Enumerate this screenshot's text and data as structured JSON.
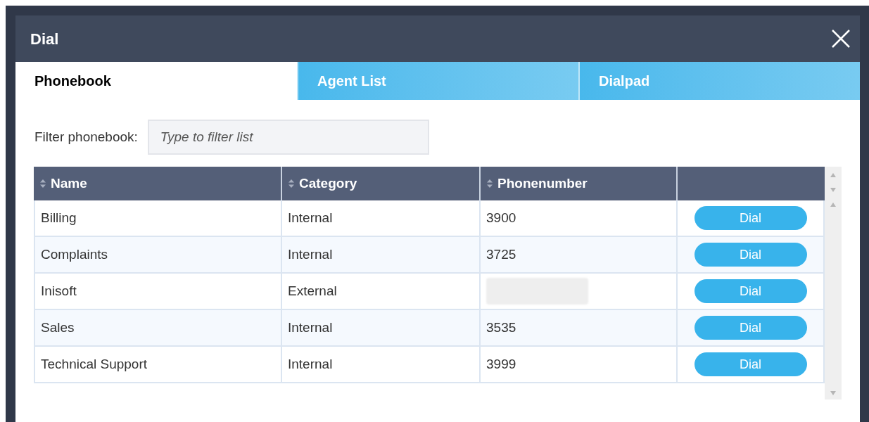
{
  "window": {
    "title": "Dial"
  },
  "tabs": [
    {
      "label": "Phonebook",
      "selected": true
    },
    {
      "label": "Agent List",
      "selected": false
    },
    {
      "label": "Dialpad",
      "selected": false
    }
  ],
  "filter": {
    "label": "Filter phonebook:",
    "placeholder": "Type to filter list"
  },
  "table": {
    "columns": [
      "Name",
      "Category",
      "Phonenumber"
    ],
    "rows": [
      {
        "name": "Billing",
        "category": "Internal",
        "number": "3900",
        "number_redacted": false,
        "action": "Dial"
      },
      {
        "name": "Complaints",
        "category": "Internal",
        "number": "3725",
        "number_redacted": false,
        "action": "Dial"
      },
      {
        "name": "Inisoft",
        "category": "External",
        "number_redacted": true,
        "action": "Dial"
      },
      {
        "name": "Sales",
        "category": "Internal",
        "number": "3535",
        "number_redacted": false,
        "action": "Dial"
      },
      {
        "name": "Technical Support",
        "category": "Internal",
        "number": "3999",
        "number_redacted": false,
        "action": "Dial"
      }
    ]
  }
}
